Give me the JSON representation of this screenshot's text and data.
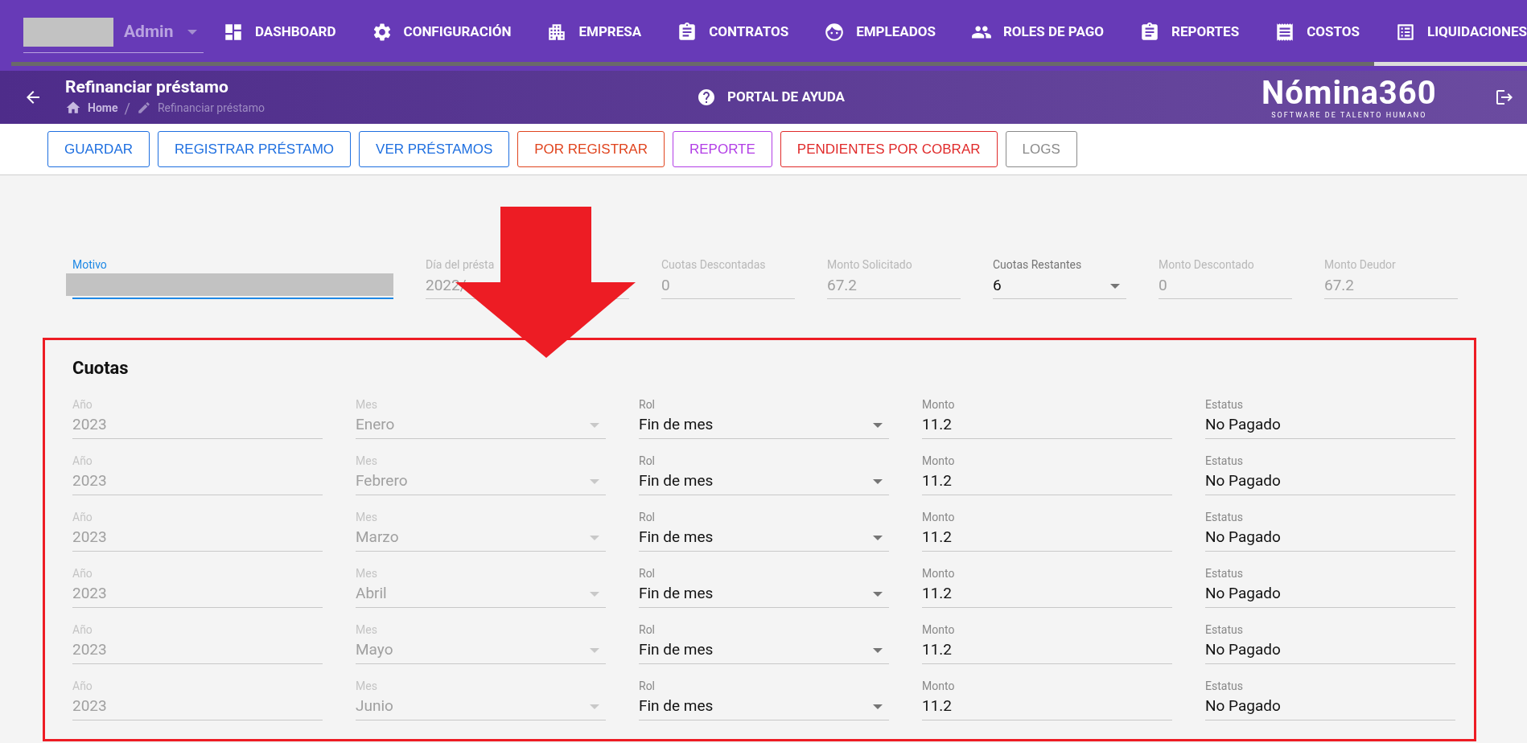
{
  "user_menu": {
    "role": "Admin"
  },
  "nav": [
    {
      "label": "DASHBOARD"
    },
    {
      "label": "CONFIGURACIÓN"
    },
    {
      "label": "EMPRESA"
    },
    {
      "label": "CONTRATOS"
    },
    {
      "label": "EMPLEADOS"
    },
    {
      "label": "ROLES DE PAGO"
    },
    {
      "label": "REPORTES"
    },
    {
      "label": "COSTOS"
    },
    {
      "label": "LIQUIDACIONES"
    }
  ],
  "header": {
    "title": "Refinanciar préstamo",
    "breadcrumb": [
      "Home",
      "Refinanciar préstamo"
    ],
    "breadcrumb_separator": "/",
    "help": "PORTAL DE AYUDA",
    "logo": "Nómina360",
    "logo_tagline": "SOFTWARE DE TALENTO HUMANO"
  },
  "actions": [
    {
      "label": "GUARDAR",
      "color": "#1e6fe0"
    },
    {
      "label": "REGISTRAR PRÉSTAMO",
      "color": "#1e6fe0"
    },
    {
      "label": "VER PRÉSTAMOS",
      "color": "#1e6fe0"
    },
    {
      "label": "POR REGISTRAR",
      "color": "#e0441e"
    },
    {
      "label": "REPORTE",
      "color": "#b23ee6"
    },
    {
      "label": "PENDIENTES POR COBRAR",
      "color": "#e02a2a"
    },
    {
      "label": "LOGS",
      "color": "#8a8a8a"
    }
  ],
  "loan_fields": [
    {
      "label": "Motivo",
      "kind": "redacted",
      "focused": true
    },
    {
      "label": "Día del présta",
      "value": "2022/",
      "kind": "text",
      "focused": false
    },
    {
      "label": "Cuotas Descontadas",
      "value": "0",
      "kind": "text",
      "focused": false
    },
    {
      "label": "Monto Solicitado",
      "value": "67.2",
      "kind": "text",
      "focused": false
    },
    {
      "label": "Cuotas Restantes",
      "value": "6",
      "kind": "select",
      "focused": false
    },
    {
      "label": "Monto Descontado",
      "value": "0",
      "kind": "text",
      "focused": false
    },
    {
      "label": "Monto Deudor",
      "value": "67.2",
      "kind": "text",
      "focused": false
    }
  ],
  "cuotas": {
    "title": "Cuotas",
    "rows": [
      {
        "fields": [
          {
            "label": "Año",
            "value": "2023",
            "kind": "disabled"
          },
          {
            "label": "Mes",
            "value": "Enero",
            "kind": "disabled-select"
          },
          {
            "label": "Rol",
            "value": "Fin de mes",
            "kind": "select"
          },
          {
            "label": "Monto",
            "value": "11.2",
            "kind": "text"
          },
          {
            "label": "Estatus",
            "value": "No Pagado",
            "kind": "text"
          }
        ]
      },
      {
        "fields": [
          {
            "label": "Año",
            "value": "2023",
            "kind": "disabled"
          },
          {
            "label": "Mes",
            "value": "Febrero",
            "kind": "disabled-select"
          },
          {
            "label": "Rol",
            "value": "Fin de mes",
            "kind": "select"
          },
          {
            "label": "Monto",
            "value": "11.2",
            "kind": "text"
          },
          {
            "label": "Estatus",
            "value": "No Pagado",
            "kind": "text"
          }
        ]
      },
      {
        "fields": [
          {
            "label": "Año",
            "value": "2023",
            "kind": "disabled"
          },
          {
            "label": "Mes",
            "value": "Marzo",
            "kind": "disabled-select"
          },
          {
            "label": "Rol",
            "value": "Fin de mes",
            "kind": "select"
          },
          {
            "label": "Monto",
            "value": "11.2",
            "kind": "text"
          },
          {
            "label": "Estatus",
            "value": "No Pagado",
            "kind": "text"
          }
        ]
      },
      {
        "fields": [
          {
            "label": "Año",
            "value": "2023",
            "kind": "disabled"
          },
          {
            "label": "Mes",
            "value": "Abril",
            "kind": "disabled-select"
          },
          {
            "label": "Rol",
            "value": "Fin de mes",
            "kind": "select"
          },
          {
            "label": "Monto",
            "value": "11.2",
            "kind": "text"
          },
          {
            "label": "Estatus",
            "value": "No Pagado",
            "kind": "text"
          }
        ]
      },
      {
        "fields": [
          {
            "label": "Año",
            "value": "2023",
            "kind": "disabled"
          },
          {
            "label": "Mes",
            "value": "Mayo",
            "kind": "disabled-select"
          },
          {
            "label": "Rol",
            "value": "Fin de mes",
            "kind": "select"
          },
          {
            "label": "Monto",
            "value": "11.2",
            "kind": "text"
          },
          {
            "label": "Estatus",
            "value": "No Pagado",
            "kind": "text"
          }
        ]
      },
      {
        "fields": [
          {
            "label": "Año",
            "value": "2023",
            "kind": "disabled"
          },
          {
            "label": "Mes",
            "value": "Junio",
            "kind": "disabled-select"
          },
          {
            "label": "Rol",
            "value": "Fin de mes",
            "kind": "select"
          },
          {
            "label": "Monto",
            "value": "11.2",
            "kind": "text"
          },
          {
            "label": "Estatus",
            "value": "No Pagado",
            "kind": "text"
          }
        ]
      }
    ]
  }
}
